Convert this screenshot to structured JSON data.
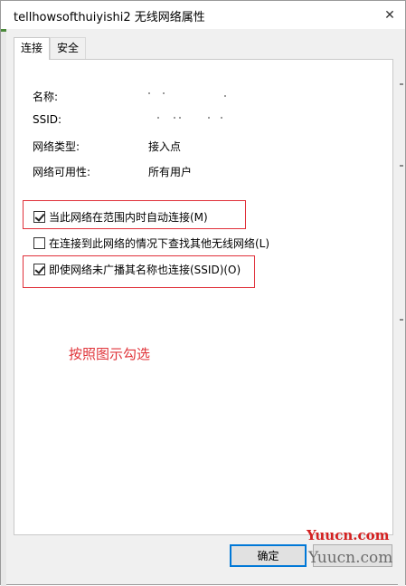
{
  "window": {
    "title": "tellhowsofthuiyishi2 无线网络属性",
    "close_glyph": "✕"
  },
  "tabs": [
    {
      "label": "连接",
      "active": true
    },
    {
      "label": "安全",
      "active": false
    }
  ],
  "properties": [
    {
      "label": "名称:",
      "value": ""
    },
    {
      "label": "SSID:",
      "value": ""
    },
    {
      "label": "网络类型:",
      "value": "接入点"
    },
    {
      "label": "网络可用性:",
      "value": "所有用户"
    }
  ],
  "checkboxes": [
    {
      "label": "当此网络在范围内时自动连接(M)",
      "checked": true,
      "highlighted": true
    },
    {
      "label": "在连接到此网络的情况下查找其他无线网络(L)",
      "checked": false,
      "highlighted": false
    },
    {
      "label": "即使网络未广播其名称也连接(SSID)(O)",
      "checked": true,
      "highlighted": true
    }
  ],
  "annotation": "按照图示勾选",
  "buttons": {
    "ok_label": "确定"
  },
  "watermark": {
    "top": "Yuucn.com",
    "bottom": "Yuucn.com"
  },
  "colors": {
    "highlight_box": "#e0303a",
    "annotation_text": "#e0343a",
    "ok_button_border": "#0078d7"
  }
}
